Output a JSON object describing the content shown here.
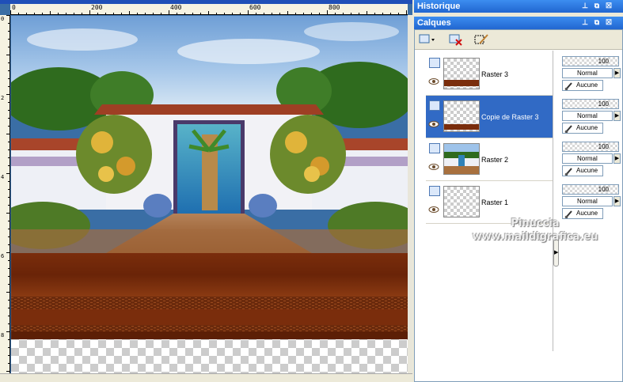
{
  "ruler": {
    "top_labels": [
      "0",
      "200",
      "400",
      "600",
      "800"
    ],
    "left_labels": [
      "0",
      "2",
      "4",
      "6",
      "8"
    ]
  },
  "panels": {
    "history_title": "Historique",
    "layers_title": "Calques"
  },
  "layers": [
    {
      "name": "Raster 3",
      "opacity": "100",
      "blend": "Normal",
      "mask": "Aucune",
      "selected": false,
      "thumb": "brown-strip"
    },
    {
      "name": "Copie de Raster 3",
      "opacity": "100",
      "blend": "Normal",
      "mask": "Aucune",
      "selected": true,
      "thumb": "brown-strip"
    },
    {
      "name": "Raster 2",
      "opacity": "100",
      "blend": "Normal",
      "mask": "Aucune",
      "selected": false,
      "thumb": "scene"
    },
    {
      "name": "Raster 1",
      "opacity": "100",
      "blend": "Normal",
      "mask": "Aucune",
      "selected": false,
      "thumb": "empty"
    }
  ],
  "watermark": {
    "line1": "Pinuccia",
    "line2": "www.maildigrafica.eu"
  },
  "colors": {
    "title_bar": "#2166d0",
    "selection": "#316ac5",
    "brown_band": "#7a2d0c"
  },
  "icons": {
    "toolbar": [
      "new-layer-icon",
      "delete-layer-icon",
      "edit-selection-icon"
    ],
    "title_buttons": [
      "pin-icon",
      "restore-icon",
      "close-icon"
    ]
  }
}
